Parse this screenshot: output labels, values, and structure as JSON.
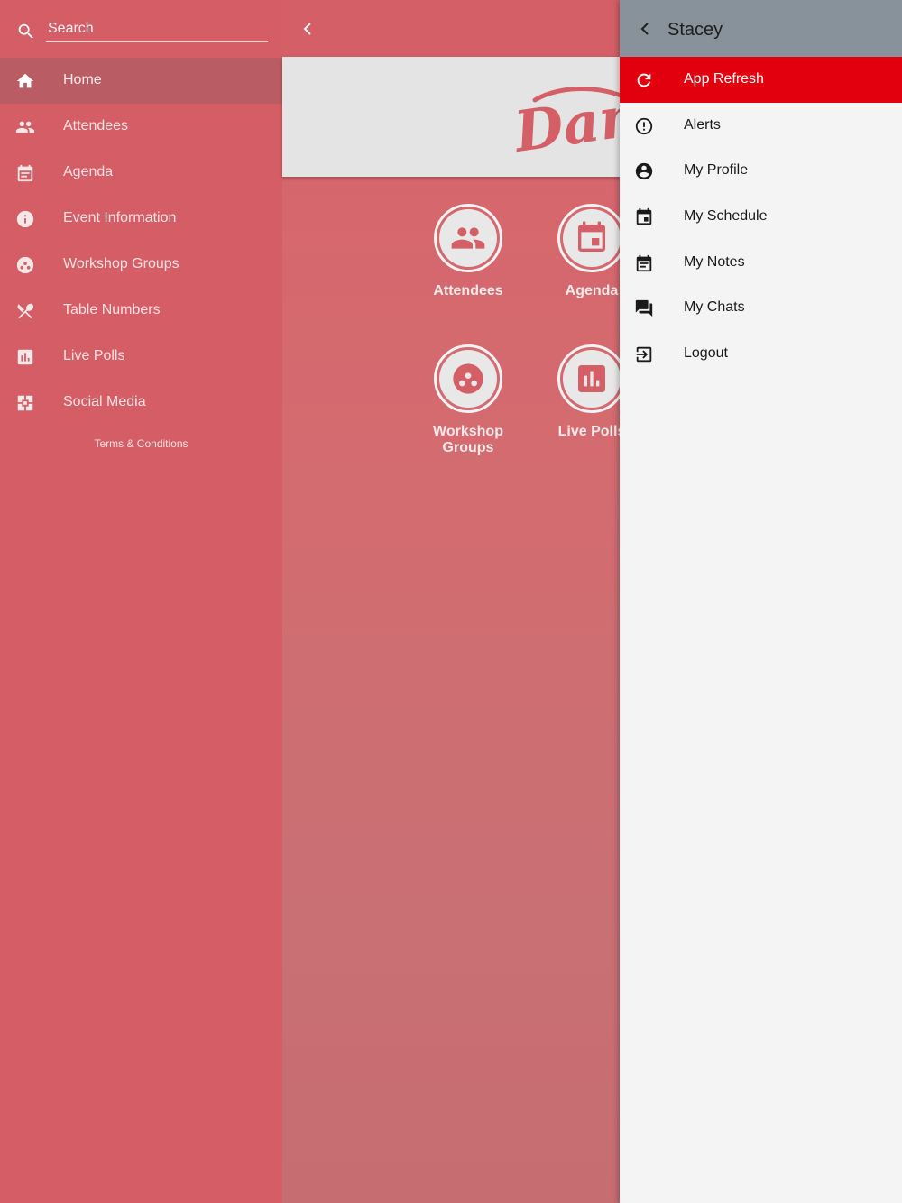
{
  "sidebar": {
    "search": {
      "placeholder": "Search"
    },
    "items": [
      {
        "label": "Home",
        "icon": "home-icon",
        "active": true
      },
      {
        "label": "Attendees",
        "icon": "people-icon"
      },
      {
        "label": "Agenda",
        "icon": "calendar-icon"
      },
      {
        "label": "Event Information",
        "icon": "info-icon"
      },
      {
        "label": "Workshop Groups",
        "icon": "groups-icon"
      },
      {
        "label": "Table Numbers",
        "icon": "cutlery-icon"
      },
      {
        "label": "Live Polls",
        "icon": "poll-icon"
      },
      {
        "label": "Social Media",
        "icon": "social-icon"
      }
    ],
    "terms_label": "Terms & Conditions"
  },
  "main": {
    "banner": {
      "logo_text": "Danfoss"
    },
    "tiles": [
      {
        "label": "Attendees",
        "icon": "people-icon"
      },
      {
        "label": "Agenda",
        "icon": "calendar-icon"
      },
      {
        "label": "Workshop Groups",
        "icon": "groups-icon"
      },
      {
        "label": "Live Polls",
        "icon": "poll-icon"
      }
    ]
  },
  "drawer": {
    "title": "Stacey",
    "items": [
      {
        "label": "App Refresh",
        "icon": "refresh-icon",
        "highlight": true
      },
      {
        "label": "Alerts",
        "icon": "alert-icon"
      },
      {
        "label": "My Profile",
        "icon": "profile-icon"
      },
      {
        "label": "My Schedule",
        "icon": "schedule-icon"
      },
      {
        "label": "My Notes",
        "icon": "notes-icon"
      },
      {
        "label": "My Chats",
        "icon": "chat-icon"
      },
      {
        "label": "Logout",
        "icon": "logout-icon"
      }
    ]
  },
  "colors": {
    "primary": "#d45d66",
    "accent": "#e2000f",
    "drawer_header": "#87929a",
    "drawer_bg": "#f4f4f4"
  }
}
